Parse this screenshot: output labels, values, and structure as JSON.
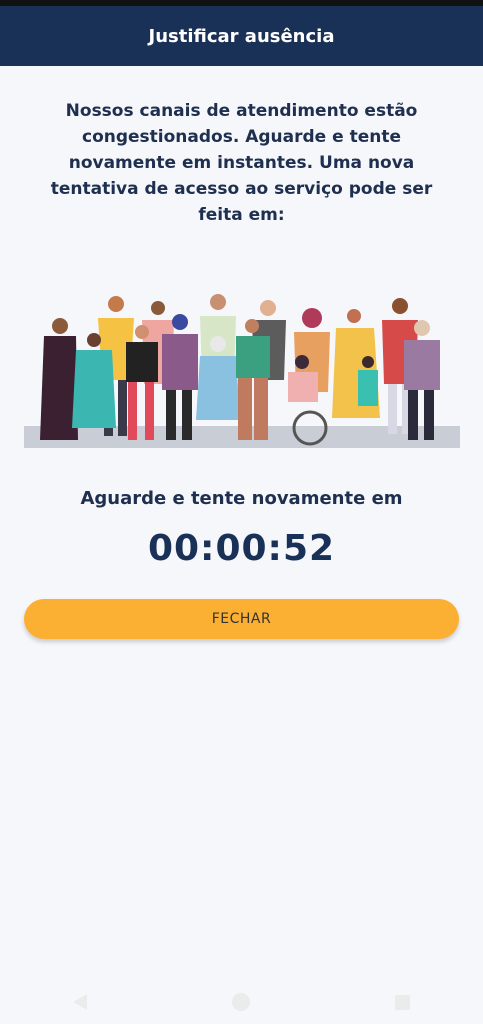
{
  "header": {
    "title": "Justificar ausência"
  },
  "main": {
    "message": "Nossos canais de atendimento estão congestionados. Aguarde e tente novamente em instantes. Uma nova tentativa de acesso ao serviço pode ser feita em:",
    "illustration": "people-group-illustration",
    "wait_label": "Aguarde e tente novamente em",
    "countdown": "00:00:52",
    "close_label": "FECHAR"
  },
  "colors": {
    "header_bg": "#1a3157",
    "button_bg": "#fbb034",
    "text": "#1e2f4f"
  },
  "navbar": {
    "icons": [
      "back-icon",
      "home-icon",
      "recent-apps-icon"
    ]
  }
}
